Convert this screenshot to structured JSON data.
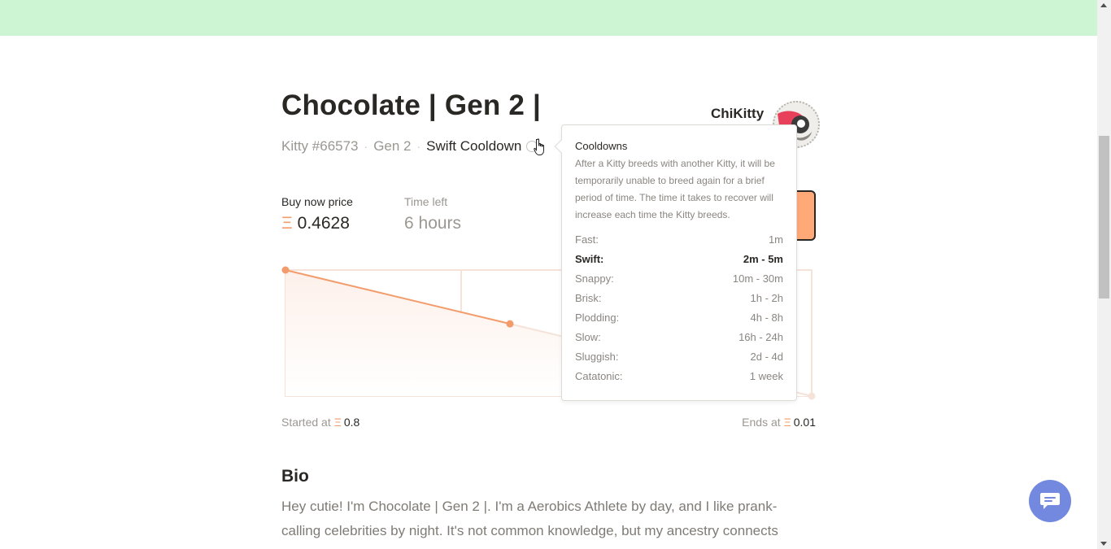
{
  "kitty": {
    "title": "Chocolate | Gen 2 |",
    "id_label": "Kitty #66573",
    "gen_label": "Gen 2",
    "cooldown_label": "Swift Cooldown"
  },
  "owner": {
    "name": "ChiKitty"
  },
  "sale": {
    "price_label": "Buy now price",
    "currency_symbol": "Ξ",
    "price_value": "0.4628",
    "time_label": "Time left",
    "time_value": "6 hours",
    "started_label": "Started at",
    "started_value": "0.8",
    "ends_label": "Ends at",
    "ends_value": "0.01"
  },
  "chart_data": {
    "type": "line",
    "series": [
      {
        "values": [
          0.8,
          0.4628,
          0.01
        ]
      }
    ],
    "colors": {
      "line": "#f39c6b",
      "fill": "#fdf0ea",
      "grid": "#f5e3d9"
    }
  },
  "tooltip": {
    "title": "Cooldowns",
    "description": "After a Kitty breeds with another Kitty, it will be temporarily unable to breed again for a brief period of time. The time it takes to recover will increase each time the Kitty breeds.",
    "rows": [
      {
        "name": "Fast:",
        "value": "1m",
        "active": false
      },
      {
        "name": "Swift:",
        "value": "2m - 5m",
        "active": true
      },
      {
        "name": "Snappy:",
        "value": "10m - 30m",
        "active": false
      },
      {
        "name": "Brisk:",
        "value": "1h - 2h",
        "active": false
      },
      {
        "name": "Plodding:",
        "value": "4h - 8h",
        "active": false
      },
      {
        "name": "Slow:",
        "value": "16h - 24h",
        "active": false
      },
      {
        "name": "Sluggish:",
        "value": "2d - 4d",
        "active": false
      },
      {
        "name": "Catatonic:",
        "value": "1 week",
        "active": false
      }
    ]
  },
  "bio": {
    "heading": "Bio",
    "text": "Hey cutie! I'm Chocolate | Gen 2 |. I'm a Aerobics Athlete by day, and I like prank-calling celebrities by night. It's not common knowledge, but my ancestry connects"
  },
  "colors": {
    "banner": "#cdf5d4",
    "accent": "#f39c6b",
    "chat_button": "#7389e0"
  },
  "icons": {
    "chat": "chat-bubble-icon",
    "help": "help-circle-icon",
    "cursor": "hand-pointer-icon"
  }
}
